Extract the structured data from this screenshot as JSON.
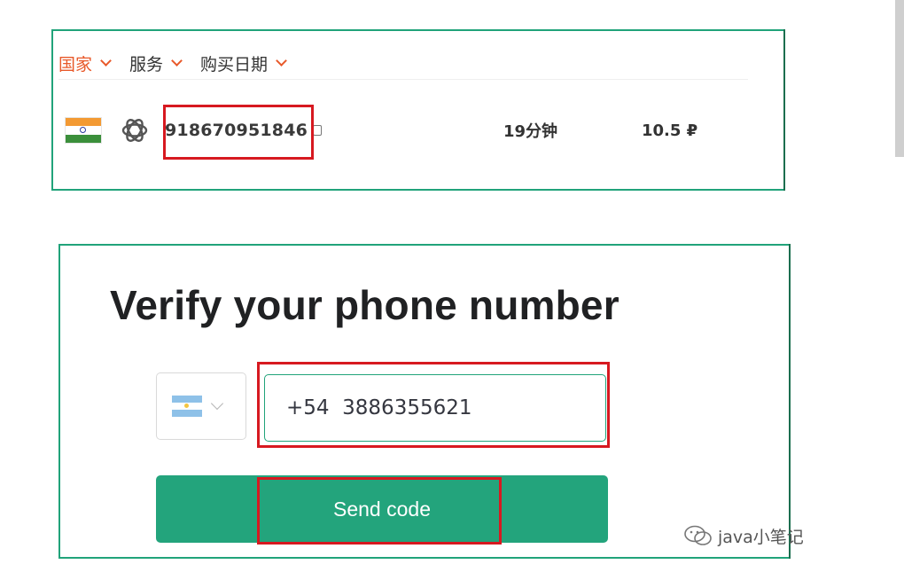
{
  "filter_bar": {
    "items": [
      {
        "label": "国家",
        "active": true
      },
      {
        "label": "服务",
        "active": false
      },
      {
        "label": "购买日期",
        "active": false
      }
    ]
  },
  "order_row": {
    "country_flag": "india-flag-icon",
    "service_icon": "openai-icon",
    "phone_number": "918670951846",
    "duration": "19分钟",
    "price": "10.5 ₽"
  },
  "verify": {
    "title": "Verify your phone number",
    "country_flag": "argentina-flag-icon",
    "phone_value": "+54  3886355621",
    "send_label": "Send code"
  },
  "watermark": {
    "text": "java小笔记"
  },
  "colors": {
    "accent_green": "#23a47c",
    "highlight_red": "#d71920",
    "filter_active": "#e8592a"
  }
}
